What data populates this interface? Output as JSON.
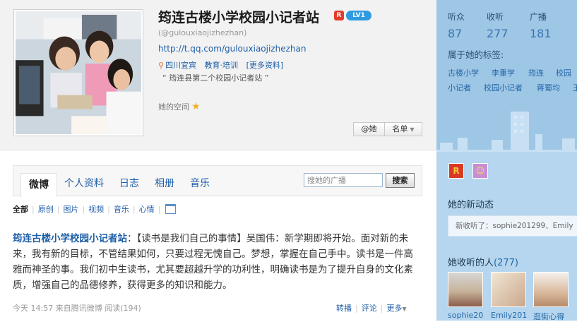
{
  "profile": {
    "display_name": "筠连古楼小学校园小记者站",
    "badges": [
      "R",
      "LV1"
    ],
    "handle": "(@gulouxiaojizhezhan)",
    "homepage": "http://t.qq.com/gulouxiaojizhezhan",
    "location": "四川宜宾",
    "industry": "教育·培训",
    "more_info": "[更多资料]",
    "bio": "“  筠连县第二个校园小记者站  ”",
    "space_link": "她的空间",
    "at_button": "@她",
    "list_button": "名单"
  },
  "tabs": [
    {
      "label": "微博"
    },
    {
      "label": "个人资料"
    },
    {
      "label": "日志"
    },
    {
      "label": "相册"
    },
    {
      "label": "音乐"
    }
  ],
  "search": {
    "placeholder": "搜她的广播",
    "button": "搜索"
  },
  "filters": [
    "全部",
    "原创",
    "图片",
    "视频",
    "音乐",
    "心情"
  ],
  "tweet": {
    "author": "筠连古楼小学校园小记者站",
    "colon": "：",
    "text": "【读书是我们自己的事情】吴国伟：新学期即将开始。面对新的未来，我有新的目标，不管结果如何，只要过程无愧自己。梦想，掌握在自己手中。读书是一件高雅而神圣的事。我们初中生读书，尤其要超越升学的功利性，明确读书是为了提升自身的文化素质，增强自己的品德修养，获得更多的知识和能力。",
    "time": "今天 14:57",
    "source": "来自腾讯微博",
    "reads": "阅读(194)",
    "actions": {
      "forward": "转播",
      "comment": "评论",
      "more": "更多"
    }
  },
  "sidebar": {
    "stats": [
      {
        "label": "听众",
        "value": "87"
      },
      {
        "label": "收听",
        "value": "277"
      },
      {
        "label": "广播",
        "value": "181"
      }
    ],
    "tags_title": "属于她的标签:",
    "tags": [
      "古楼小学",
      "李重学",
      "筠连",
      "校园",
      "王",
      "小记者",
      "校园小记者",
      "蒋蜀均"
    ],
    "news_title": "她的新动态",
    "news_text": "新收听了：sophie201299、Emily",
    "following_title": "她收听的人",
    "following_count": "(277)",
    "following": [
      {
        "name": "sophie20"
      },
      {
        "name": "Emily201"
      },
      {
        "name": "逛街心得"
      }
    ]
  }
}
